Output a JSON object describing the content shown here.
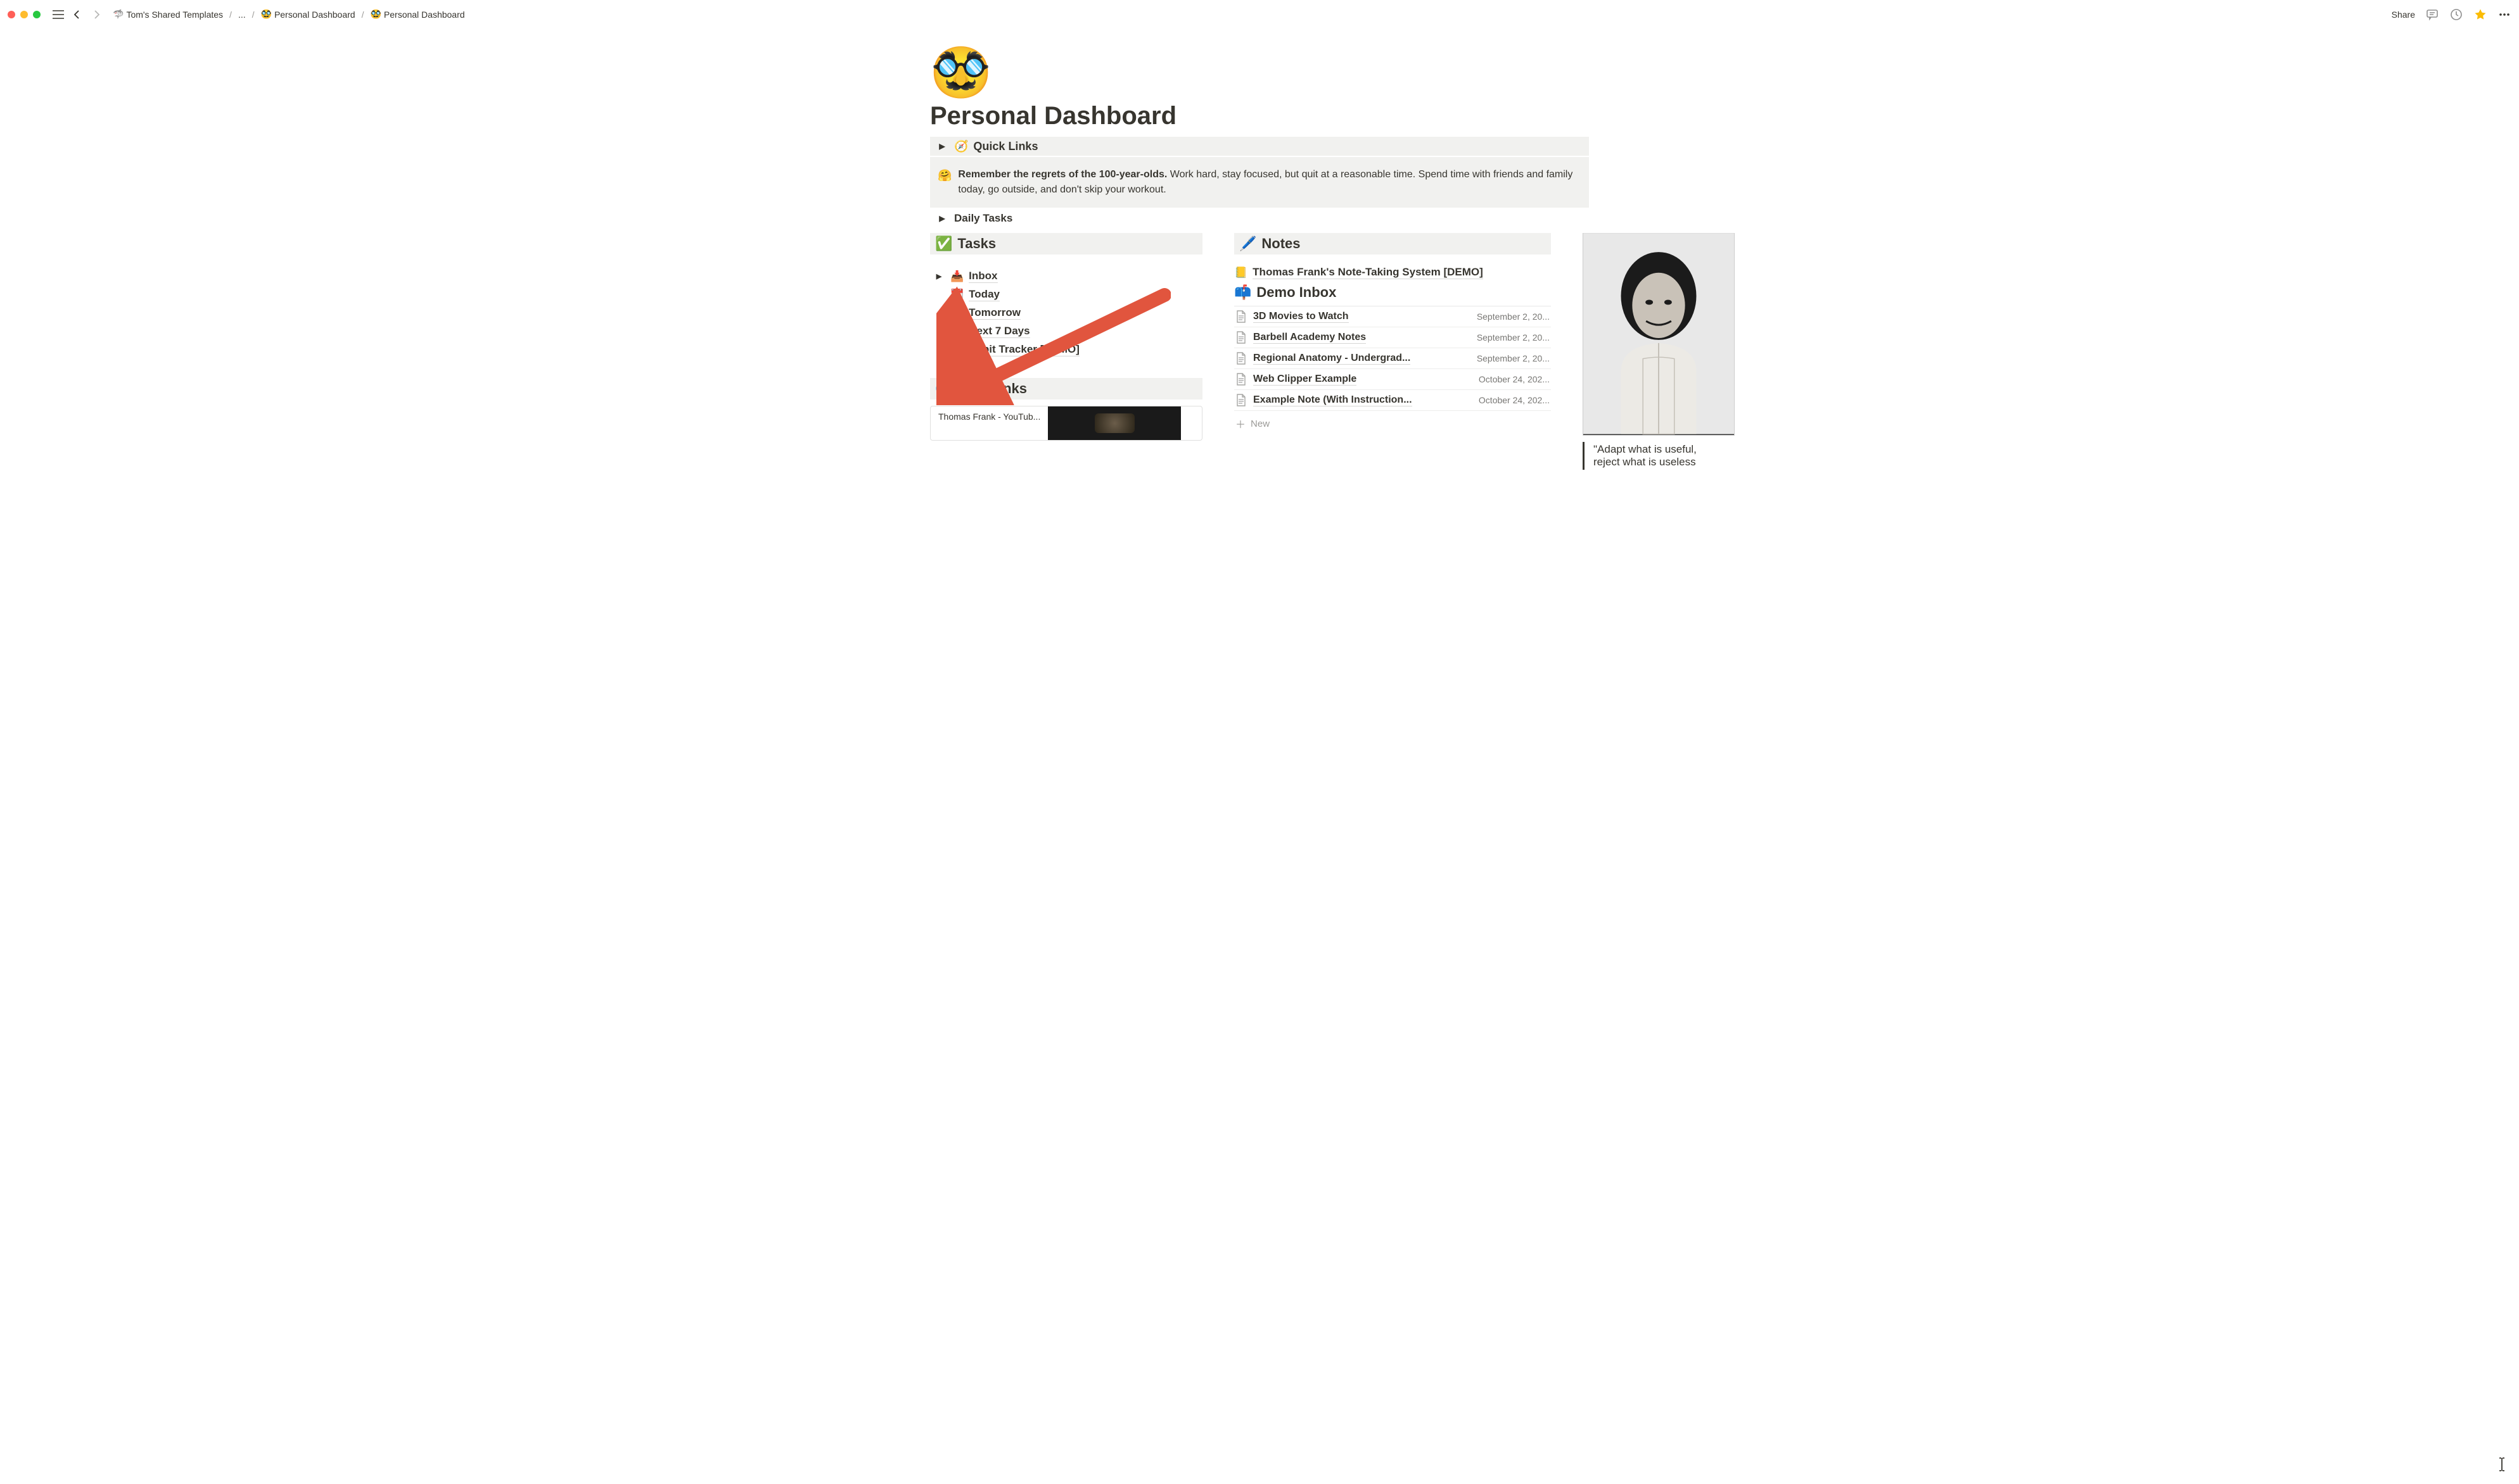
{
  "breadcrumbs": {
    "root_icon": "🦈",
    "root": "Tom's Shared Templates",
    "ellipsis": "...",
    "mid_icon": "🥸",
    "mid": "Personal Dashboard",
    "leaf_icon": "🥸",
    "leaf": "Personal Dashboard"
  },
  "topbar": {
    "share": "Share"
  },
  "page": {
    "icon": "🥸",
    "title": "Personal Dashboard"
  },
  "quick_links": {
    "icon": "🧭",
    "label": "Quick Links"
  },
  "callout": {
    "emoji": "🤗",
    "bold": "Remember the regrets of the 100-year-olds.",
    "text": " Work hard, stay focused, but quit at a reasonable time. Spend time with friends and family today, go outside, and don't skip your workout."
  },
  "daily_tasks": {
    "label": "Daily Tasks"
  },
  "tasks": {
    "header_icon": "✅",
    "header_label": "Tasks",
    "items": [
      {
        "caret": true,
        "icon": "📥",
        "label": "Inbox"
      },
      {
        "caret": false,
        "icon": "📆",
        "label": "Today"
      },
      {
        "caret": false,
        "icon": "🌅",
        "label": "Tomorrow"
      },
      {
        "caret": false,
        "icon": "🗓️",
        "label": "Next 7 Days"
      },
      {
        "caret": false,
        "icon": "💪",
        "label": "Habit Tracker [DEMO]"
      }
    ]
  },
  "web_links": {
    "header_icon": "🌐",
    "header_label": "Web Links",
    "card_title": "Thomas Frank - YouTub..."
  },
  "notes": {
    "header_icon": "🖊️",
    "header_label": "Notes",
    "system_icon": "📒",
    "system_label": "Thomas Frank's Note-Taking System [DEMO]",
    "inbox_icon": "📫",
    "inbox_label": "Demo Inbox",
    "rows": [
      {
        "title": "3D Movies to Watch",
        "date": "September 2, 20..."
      },
      {
        "title": "Barbell Academy Notes",
        "date": "September 2, 20..."
      },
      {
        "title": "Regional Anatomy - Undergrad...",
        "date": "September 2, 20..."
      },
      {
        "title": "Web Clipper Example",
        "date": "October 24, 202..."
      },
      {
        "title": "Example Note (With Instruction...",
        "date": "October 24, 202..."
      }
    ],
    "new_label": "New"
  },
  "quote": {
    "line1": "\"Adapt what is useful,",
    "line2": "reject what is useless"
  }
}
